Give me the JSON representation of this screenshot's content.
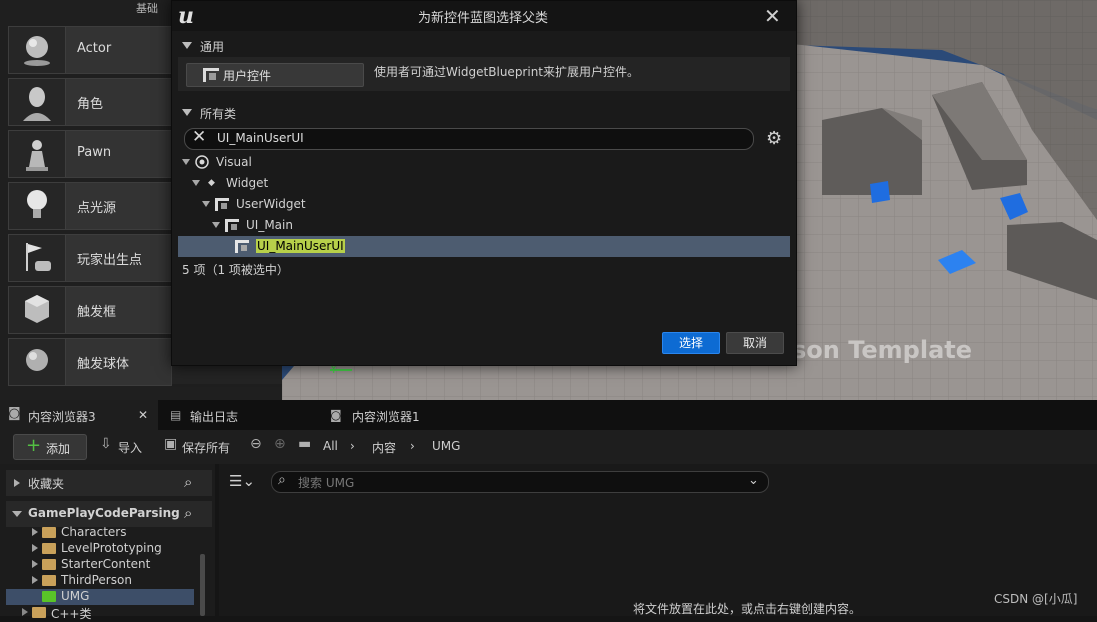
{
  "place_panel": {
    "category_label": "基础",
    "items": [
      {
        "label": "Actor",
        "icon": "sphere-actor-icon"
      },
      {
        "label": "角色",
        "icon": "character-bust-icon"
      },
      {
        "label": "Pawn",
        "icon": "pawn-piece-icon"
      },
      {
        "label": "点光源",
        "icon": "light-bulb-icon"
      },
      {
        "label": "玩家出生点",
        "icon": "player-start-flag-icon"
      },
      {
        "label": "触发框",
        "icon": "trigger-box-icon"
      },
      {
        "label": "触发球体",
        "icon": "trigger-sphere-icon"
      }
    ]
  },
  "viewport": {
    "template_text": "son Template",
    "axis_label": "Y"
  },
  "dialog": {
    "title": "为新控件蓝图选择父类",
    "common_section": "通用",
    "common_button": "用户控件",
    "common_description": "使用者可通过WidgetBlueprint来扩展用户控件。",
    "all_classes_section": "所有类",
    "search_value": "UI_MainUserUI",
    "tree": [
      {
        "label": "Visual"
      },
      {
        "label": "Widget"
      },
      {
        "label": "UserWidget"
      },
      {
        "label": "UI_Main"
      },
      {
        "label": "UI_MainUserUI",
        "selected": true
      }
    ],
    "count_text": "5 项（1 项被选中）",
    "select_button": "选择",
    "cancel_button": "取消"
  },
  "content_browser": {
    "tabs": [
      {
        "label": "内容浏览器3",
        "active": true
      },
      {
        "label": "输出日志",
        "active": false
      },
      {
        "label": "内容浏览器1",
        "active": false
      }
    ],
    "toolbar": {
      "add": "添加",
      "import": "导入",
      "save_all": "保存所有",
      "breadcrumb": [
        "All",
        "内容",
        "UMG"
      ]
    },
    "favorites": "收藏夹",
    "project": "GamePlayCodeParsing",
    "folders": [
      {
        "label": "Characters"
      },
      {
        "label": "LevelPrototyping"
      },
      {
        "label": "StarterContent"
      },
      {
        "label": "ThirdPerson"
      },
      {
        "label": "UMG",
        "selected": true
      },
      {
        "label": "C++类"
      }
    ],
    "search_placeholder": "搜索 UMG",
    "empty_hint": "将文件放置在此处，或点击右键创建内容。"
  },
  "watermark": "CSDN @[小瓜]"
}
